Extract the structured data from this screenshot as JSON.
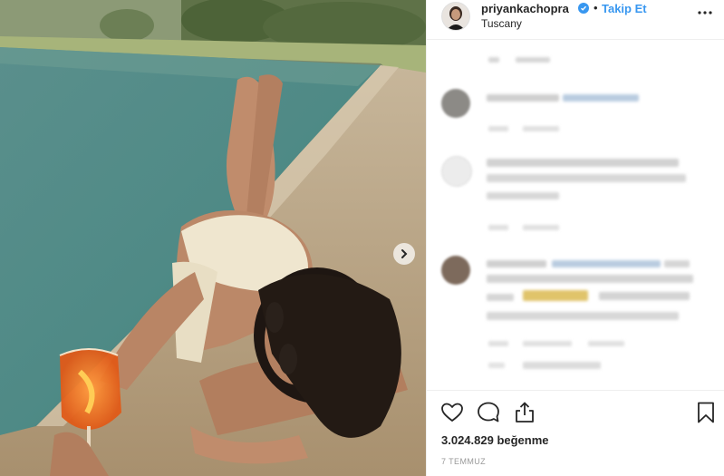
{
  "post": {
    "username": "priyankachopra",
    "follow_label": "Takip Et",
    "separator": "•",
    "location": "Tuscany",
    "likes": "3.024.829 beğenme",
    "date": "7 TEMMUZ"
  },
  "icons": {
    "verified": "verified-badge-icon",
    "more": "more-options-icon",
    "like": "heart-icon",
    "comment": "comment-icon",
    "share": "share-icon",
    "save": "bookmark-icon",
    "next": "chevron-right-icon"
  },
  "colors": {
    "accent": "#3897f0",
    "text": "#262626",
    "muted": "#999999",
    "border": "#efefef"
  }
}
